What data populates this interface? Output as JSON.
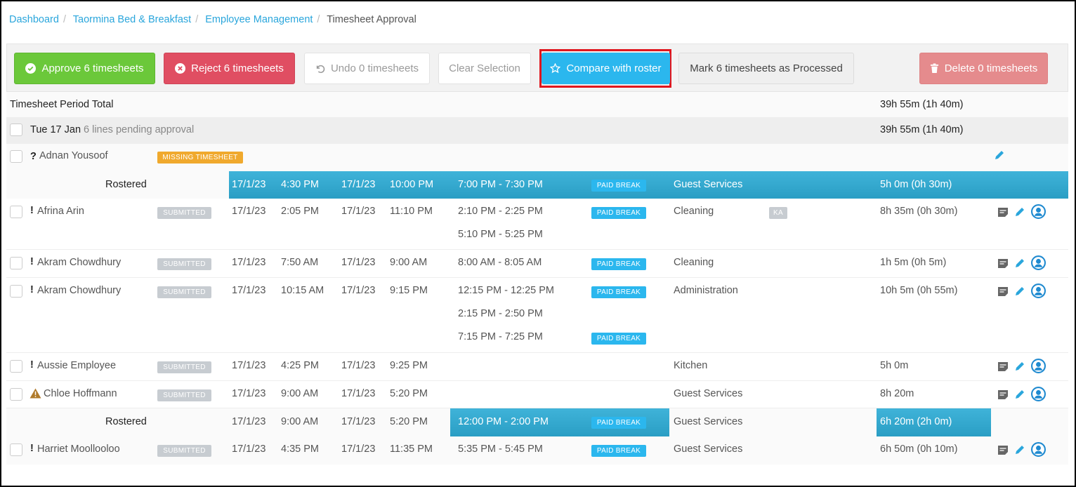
{
  "breadcrumb": {
    "items": [
      "Dashboard",
      "Taormina Bed & Breakfast",
      "Employee Management"
    ],
    "current": "Timesheet Approval"
  },
  "toolbar": {
    "approve": "Approve 6 timesheets",
    "reject": "Reject 6 timesheets",
    "undo": "Undo 0 timesheets",
    "clear": "Clear Selection",
    "compare": "Compare with roster",
    "processed": "Mark 6 timesheets as Processed",
    "delete": "Delete 0 timesheets"
  },
  "period_total": {
    "label": "Timesheet Period Total",
    "value": "39h 55m (1h 40m)"
  },
  "day": {
    "label": "Tue 17 Jan",
    "pending": "6 lines pending approval",
    "value": "39h 55m (1h 40m)"
  },
  "missing": {
    "marker": "?",
    "name": "Adnan Yousoof",
    "status": "MISSING TIMESHEET"
  },
  "rostered_label": "Rostered",
  "paid_break": "PAID BREAK",
  "rostered1": {
    "start_date": "17/1/23",
    "start_time": "4:30 PM",
    "end_date": "17/1/23",
    "end_time": "10:00 PM",
    "break": "7:00 PM - 7:30 PM",
    "area": "Guest Services",
    "total": "5h 0m (0h 30m)"
  },
  "entries": [
    {
      "marker": "!",
      "name": "Afrina Arin",
      "status": "SUBMITTED",
      "start_date": "17/1/23",
      "start_time": "2:05 PM",
      "end_date": "17/1/23",
      "end_time": "11:10 PM",
      "breaks": [
        "2:10 PM - 2:25 PM",
        "5:10 PM - 5:25 PM"
      ],
      "area": "Cleaning",
      "tag": "KA",
      "total": "8h 35m (0h 30m)"
    },
    {
      "marker": "!",
      "name": "Akram Chowdhury",
      "status": "SUBMITTED",
      "start_date": "17/1/23",
      "start_time": "7:50 AM",
      "end_date": "17/1/23",
      "end_time": "9:00 AM",
      "breaks": [
        "8:00 AM - 8:05 AM"
      ],
      "area": "Cleaning",
      "total": "1h 5m (0h 5m)"
    },
    {
      "marker": "!",
      "name": "Akram Chowdhury",
      "status": "SUBMITTED",
      "start_date": "17/1/23",
      "start_time": "10:15 AM",
      "end_date": "17/1/23",
      "end_time": "9:15 PM",
      "breaks": [
        "12:15 PM - 12:25 PM",
        "2:15 PM - 2:50 PM",
        "7:15 PM - 7:25 PM"
      ],
      "area": "Administration",
      "total": "10h 5m (0h 55m)"
    },
    {
      "marker": "!",
      "name": "Aussie Employee",
      "status": "SUBMITTED",
      "start_date": "17/1/23",
      "start_time": "4:25 PM",
      "end_date": "17/1/23",
      "end_time": "9:25 PM",
      "area": "Kitchen",
      "total": "5h 0m"
    },
    {
      "name": "Chloe Hoffmann",
      "status": "SUBMITTED",
      "start_date": "17/1/23",
      "start_time": "9:00 AM",
      "end_date": "17/1/23",
      "end_time": "5:20 PM",
      "area": "Guest Services",
      "total": "8h 20m"
    },
    {
      "marker": "!",
      "name": "Harriet Moollooloo",
      "status": "SUBMITTED",
      "start_date": "17/1/23",
      "start_time": "4:35 PM",
      "end_date": "17/1/23",
      "end_time": "11:35 PM",
      "breaks": [
        "5:35 PM - 5:45 PM"
      ],
      "area": "Guest Services",
      "total": "6h 50m (0h 10m)"
    }
  ],
  "rostered2": {
    "start_date": "17/1/23",
    "start_time": "9:00 AM",
    "end_date": "17/1/23",
    "end_time": "5:20 PM",
    "break": "12:00 PM - 2:00 PM",
    "area": "Guest Services",
    "total": "6h 20m (2h 0m)"
  },
  "colors": {
    "accent": "#2bb7ee",
    "approve": "#6bc83a",
    "reject": "#e04e62",
    "delete": "#e58b8d",
    "warning": "#f0a92d",
    "roster_band": "#2a9ec4"
  }
}
